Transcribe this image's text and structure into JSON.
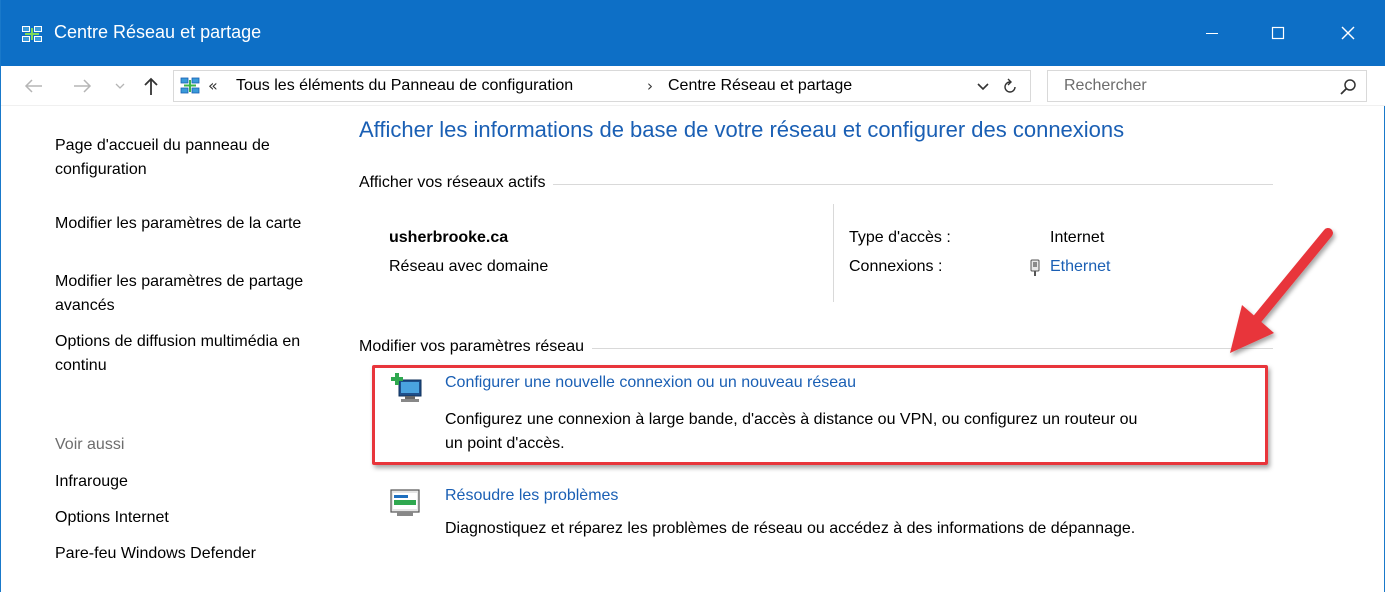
{
  "window": {
    "title": "Centre Réseau et partage"
  },
  "address_bar": {
    "breadcrumb_prefix": "«",
    "crumbs": [
      "Tous les éléments du Panneau de configuration",
      "Centre Réseau et partage"
    ],
    "separator": "›"
  },
  "search": {
    "placeholder": "Rechercher"
  },
  "sidebar": {
    "links": [
      "Page d'accueil du panneau de configuration",
      "Modifier les paramètres de la carte",
      "Modifier les paramètres de partage avancés",
      "Options de diffusion multimédia en continu"
    ],
    "see_also_heading": "Voir aussi",
    "see_also": [
      "Infrarouge",
      "Options Internet",
      "Pare-feu Windows Defender"
    ]
  },
  "main": {
    "title": "Afficher les informations de base de votre réseau et configurer des connexions",
    "active_networks_label": "Afficher vos réseaux actifs",
    "network": {
      "name": "usherbrooke.ca",
      "category": "Réseau avec domaine",
      "access_type_label": "Type d'accès :",
      "access_type_value": "Internet",
      "connections_label": "Connexions :",
      "connections_value": "Ethernet"
    },
    "change_settings_label": "Modifier vos paramètres réseau",
    "tasks": [
      {
        "link": "Configurer une nouvelle connexion ou un nouveau réseau",
        "desc_line1": "Configurez une connexion à large bande, d'accès à distance ou VPN, ou configurez un routeur ou",
        "desc_line2": "un point d'accès."
      },
      {
        "link": "Résoudre les problèmes",
        "desc_line1": "Diagnostiquez et réparez les problèmes de réseau ou accédez à des informations de dépannage."
      }
    ]
  },
  "colors": {
    "titlebar": "#0d6fc6",
    "link": "#1a5fb4",
    "highlight": "#e8353b"
  }
}
